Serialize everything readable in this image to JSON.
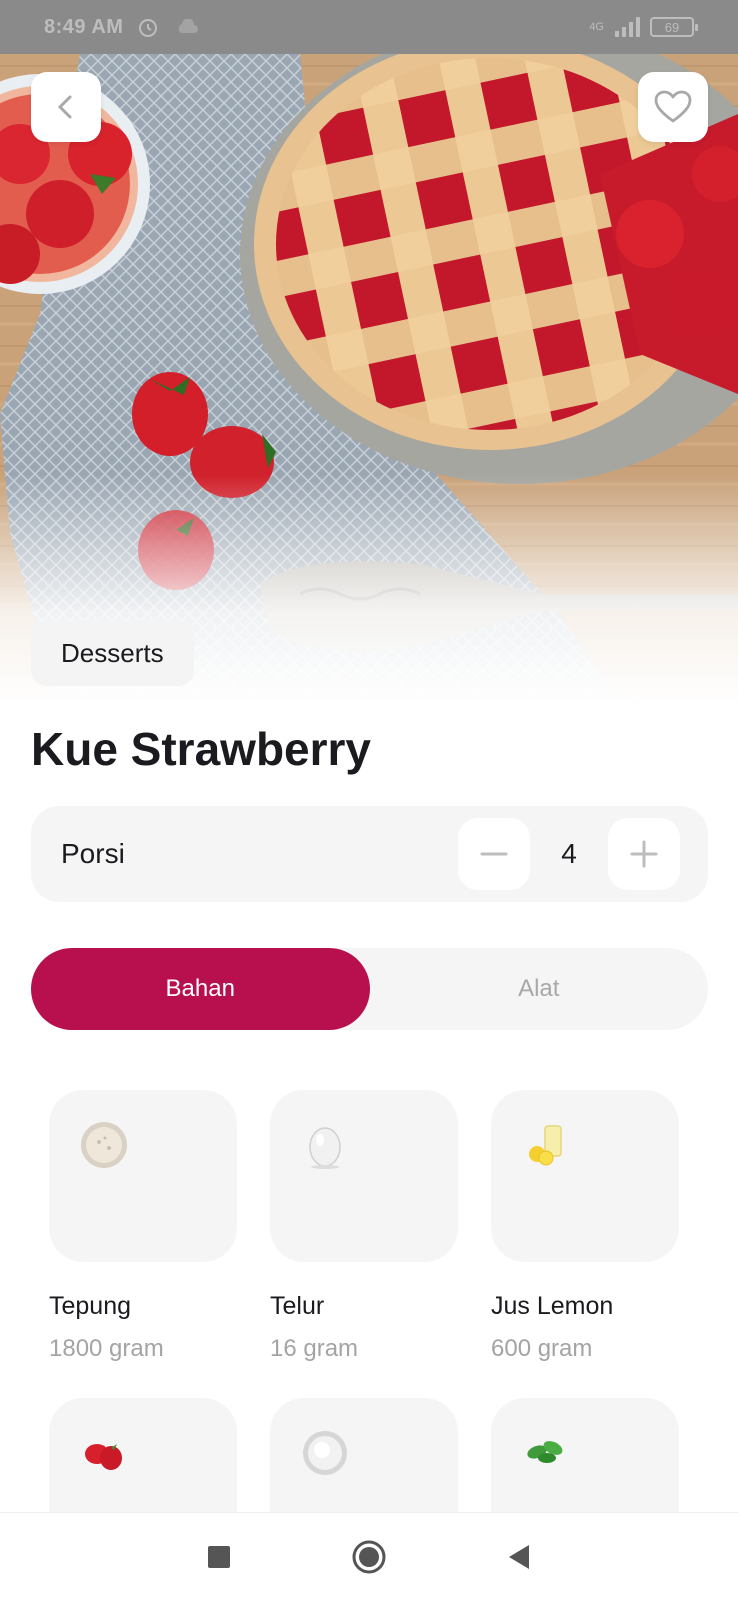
{
  "status_bar": {
    "time": "8:49 AM",
    "network": "4G",
    "battery": "69",
    "icons": [
      "alarm-icon",
      "cloud-icon",
      "signal-icon",
      "battery-icon"
    ]
  },
  "header": {
    "back_icon": "chevron-left-icon",
    "favorite_icon": "heart-outline-icon"
  },
  "recipe": {
    "category": "Desserts",
    "title": "Kue Strawberry"
  },
  "serving": {
    "label": "Porsi",
    "value": "4",
    "decrement_icon": "minus-icon",
    "increment_icon": "plus-icon"
  },
  "tabs": [
    {
      "label": "Bahan",
      "active": true
    },
    {
      "label": "Alat",
      "active": false
    }
  ],
  "ingredients": [
    {
      "name": "Tepung",
      "qty": "1800 gram",
      "icon": "flour-icon"
    },
    {
      "name": "Telur",
      "qty": "16 gram",
      "icon": "egg-icon"
    },
    {
      "name": "Jus Lemon",
      "qty": "600 gram",
      "icon": "lemon-juice-icon"
    },
    {
      "name": "",
      "qty": "",
      "icon": "strawberry-icon"
    },
    {
      "name": "",
      "qty": "",
      "icon": "sugar-icon"
    },
    {
      "name": "",
      "qty": "",
      "icon": "mint-leaf-icon"
    }
  ],
  "nav": {
    "recents_icon": "square-icon",
    "home_icon": "circle-icon",
    "back_icon": "triangle-back-icon"
  },
  "colors": {
    "accent": "#b8104f",
    "tile_bg": "#f5f5f5",
    "muted_text": "#a4a4a4"
  }
}
